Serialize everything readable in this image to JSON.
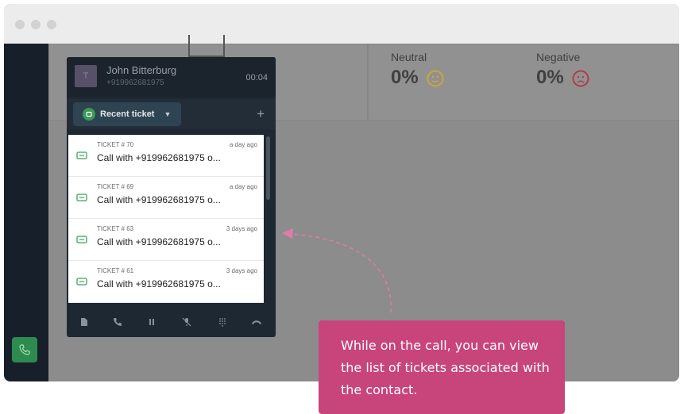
{
  "window": {
    "title": ""
  },
  "sentiment": {
    "neutral": {
      "label": "Neutral",
      "value": "0%",
      "emoji": "neutral-face-icon",
      "color": "#c9a83a"
    },
    "negative": {
      "label": "Negative",
      "value": "0%",
      "emoji": "sad-face-icon",
      "color": "#b23b4a"
    }
  },
  "call_widget": {
    "avatar_letter": "T",
    "contact_name": "John Bitterburg",
    "contact_number": "+919962681975",
    "timer": "00:04",
    "dropdown_label": "Recent ticket",
    "add_label": "+",
    "tickets": [
      {
        "id": "TICKET # 70",
        "time": "a day ago",
        "title": "Call with +919962681975 o..."
      },
      {
        "id": "TICKET # 69",
        "time": "a day ago",
        "title": "Call with +919962681975 o..."
      },
      {
        "id": "TICKET # 63",
        "time": "3 days ago",
        "title": "Call with +919962681975 o..."
      },
      {
        "id": "TICKET # 61",
        "time": "3 days ago",
        "title": "Call with +919962681975 o..."
      }
    ],
    "controls": [
      "notes-icon",
      "transfer-call-icon",
      "hold-icon",
      "mute-icon",
      "dialpad-icon",
      "hangup-icon"
    ]
  },
  "callout": {
    "text": "While on the call, you can view the list of tickets associated with the contact.",
    "color": "#c8457c"
  },
  "colors": {
    "accent": "#2e8b4f",
    "callout_pink": "#c8457c",
    "sidebar": "#17202a"
  }
}
